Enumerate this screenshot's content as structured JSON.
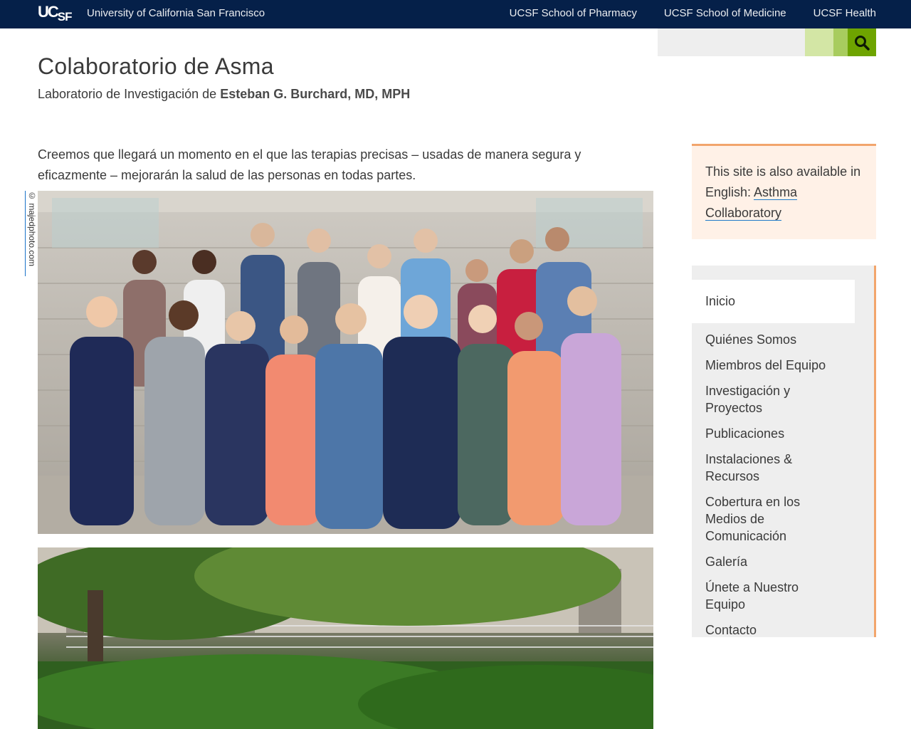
{
  "topbar": {
    "logo_uc": "UC",
    "logo_sf": "SF",
    "university": "University of California San Francisco",
    "links": [
      "UCSF School of Pharmacy",
      "UCSF School of Medicine",
      "UCSF Health"
    ]
  },
  "search": {
    "placeholder": "",
    "icon": "search-icon"
  },
  "header": {
    "title": "Colaboratorio de Asma",
    "subtitle_prefix": "Laboratorio de Investigación de ",
    "subtitle_name": "Esteban G. Burchard, MD, MPH"
  },
  "main": {
    "intro": "Creemos que llegará un momento en el que las terapias precisas – usadas de manera segura y eficazmente – mejorarán la salud de las personas en todas partes.",
    "photo_credit": "© majedphoto.com"
  },
  "notice": {
    "text": "This site is also available in English: ",
    "link": "Asthma Collaboratory"
  },
  "nav": {
    "active": "Inicio",
    "items": [
      "Quiénes Somos",
      "Miembros del Equipo",
      "Investigación y Proyectos",
      "Publicaciones",
      "Instalaciones & Recursos",
      "Cobertura en los Medios de Comunicación",
      "Galería",
      "Únete a Nuestro Equipo",
      "Contacto"
    ]
  },
  "colors": {
    "topbar": "#052049",
    "search_button": "#6ea400",
    "accent_orange": "#f2a56c",
    "notice_bg": "#fff1e7",
    "nav_bg": "#eeeeee"
  }
}
